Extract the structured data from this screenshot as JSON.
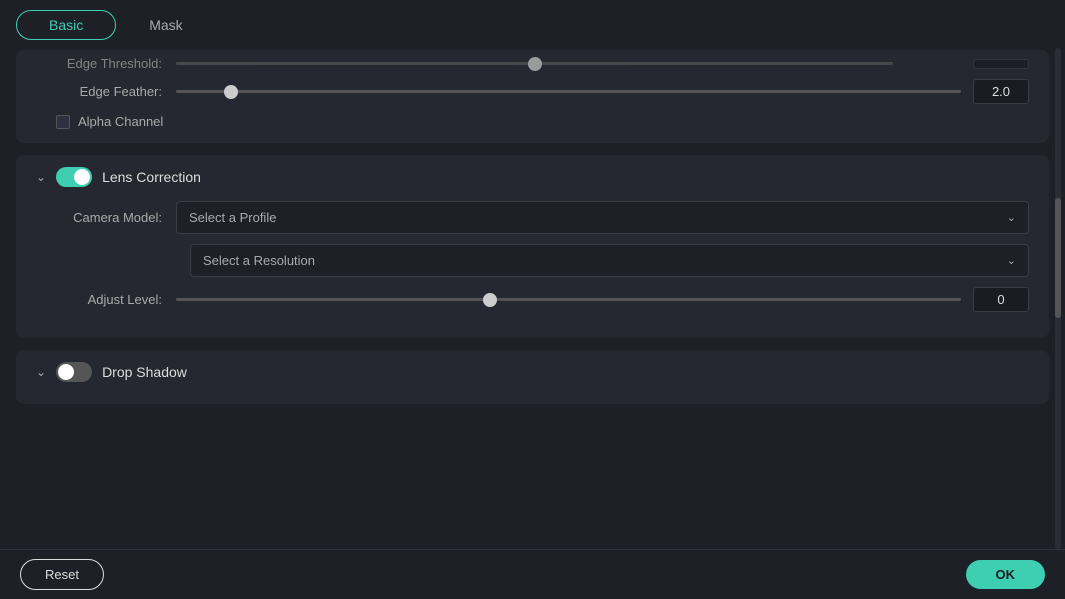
{
  "tabs": [
    {
      "id": "basic",
      "label": "Basic",
      "active": true
    },
    {
      "id": "mask",
      "label": "Mask",
      "active": false
    }
  ],
  "edge_section": {
    "edge_threshold_label": "Edge Threshold:",
    "edge_threshold_value": "",
    "edge_feather_label": "Edge Feather:",
    "edge_feather_value": "2.0",
    "edge_feather_thumb_pct": 7,
    "alpha_channel_label": "Alpha Channel"
  },
  "lens_correction": {
    "title": "Lens Correction",
    "enabled": true,
    "camera_model_label": "Camera Model:",
    "camera_model_placeholder": "Select a Profile",
    "resolution_placeholder": "Select a Resolution",
    "adjust_level_label": "Adjust Level:",
    "adjust_level_value": "0",
    "adjust_level_thumb_pct": 40
  },
  "drop_shadow": {
    "title": "Drop Shadow",
    "enabled": false
  },
  "buttons": {
    "reset": "Reset",
    "ok": "OK"
  }
}
